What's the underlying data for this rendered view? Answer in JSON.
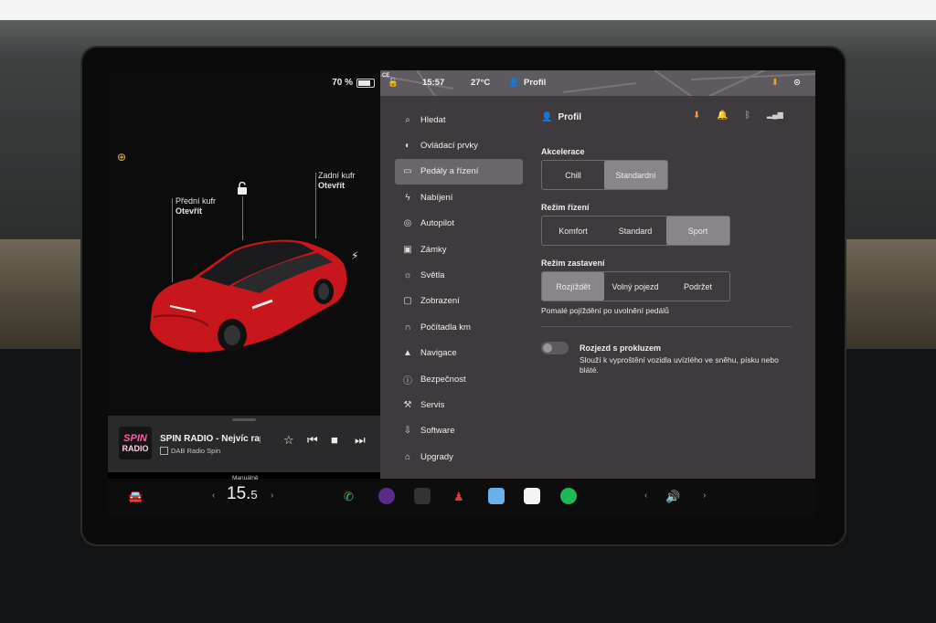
{
  "status": {
    "battery": "70 %",
    "time": "15:57",
    "temperature": "27°C",
    "profile": "Profil",
    "map_corner": "CE"
  },
  "car": {
    "front_trunk_label": "Přední kufr",
    "front_trunk_action": "Otevřít",
    "rear_trunk_label": "Zadní kufr",
    "rear_trunk_action": "Otevřít",
    "color": "#c8161d"
  },
  "media": {
    "logo_top": "SPIN",
    "logo_bottom": "RADIO",
    "title": "SPIN RADIO - Nejvíc rap",
    "source": "DAB Radio Spin"
  },
  "sidebar": {
    "items": [
      {
        "label": "Hledat",
        "icon": "search-icon"
      },
      {
        "label": "Ovládací prvky",
        "icon": "toggle-icon"
      },
      {
        "label": "Pedály a řízení",
        "icon": "car-icon",
        "active": true
      },
      {
        "label": "Nabíjení",
        "icon": "bolt-icon"
      },
      {
        "label": "Autopilot",
        "icon": "steering-wheel-icon"
      },
      {
        "label": "Zámky",
        "icon": "lock-icon"
      },
      {
        "label": "Světla",
        "icon": "light-icon"
      },
      {
        "label": "Zobrazení",
        "icon": "display-icon"
      },
      {
        "label": "Počítadla km",
        "icon": "odometer-icon"
      },
      {
        "label": "Navigace",
        "icon": "navigation-icon"
      },
      {
        "label": "Bezpečnost",
        "icon": "safety-icon"
      },
      {
        "label": "Servis",
        "icon": "wrench-icon"
      },
      {
        "label": "Software",
        "icon": "download-icon"
      },
      {
        "label": "Upgrady",
        "icon": "bag-icon"
      }
    ]
  },
  "content": {
    "profile_label": "Profil",
    "acceleration": {
      "title": "Akcelerace",
      "options": [
        "Chill",
        "Standardní"
      ],
      "selected": "Standardní"
    },
    "steering": {
      "title": "Režim řízení",
      "options": [
        "Komfort",
        "Standard",
        "Sport"
      ],
      "selected": "Sport"
    },
    "stopping": {
      "title": "Režim zastavení",
      "options": [
        "Rozjíždět",
        "Volný pojezd",
        "Podržet"
      ],
      "selected": "Rozjíždět",
      "hint": "Pomalé pojíždění po uvolnění pedálů"
    },
    "slip_start": {
      "title": "Rozjezd s prokluzem",
      "description": "Slouží k vyproštění vozidla uvízlého ve sněhu, písku nebo bláté.",
      "enabled": false
    }
  },
  "taskbar": {
    "temp_label": "Manuálně",
    "temp_value": "15.",
    "temp_decimal": "5"
  },
  "colors": {
    "accent_orange": "#f0a030",
    "panel": "#3f3a3e",
    "selected": "#8a858a",
    "spotify": "#1db954"
  }
}
